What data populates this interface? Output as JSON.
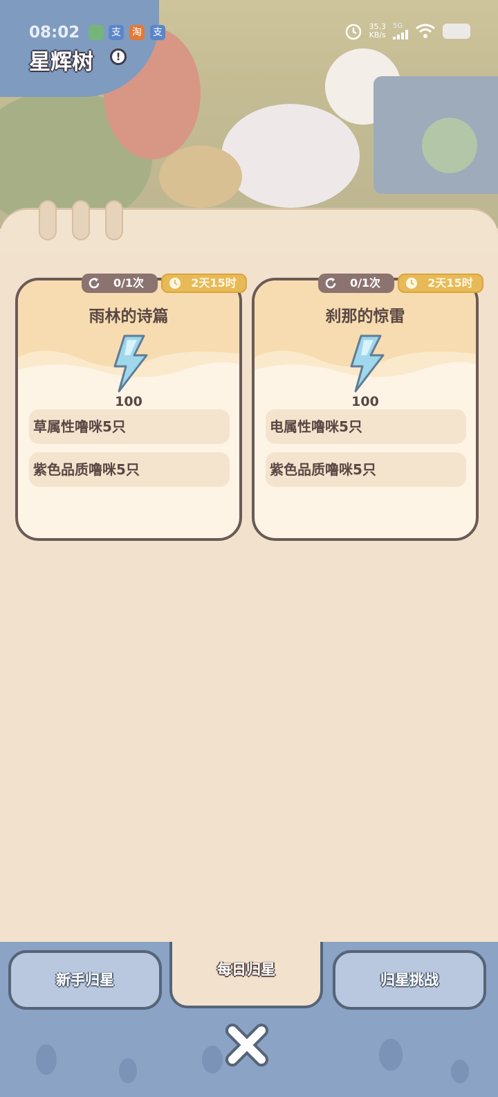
{
  "status_bar": {
    "time": "08:02",
    "apps": [
      "app-icon",
      "alipay-icon",
      "taobao-icon",
      "alipay-icon"
    ],
    "app_glyphs": [
      "",
      "支",
      "淘",
      "支"
    ],
    "speed_value": "35.3",
    "speed_unit": "KB/s",
    "network": "5G"
  },
  "header": {
    "title": "星辉树",
    "info_icon": "exclamation-icon"
  },
  "cards": [
    {
      "title": "雨林的诗篇",
      "attempts": "0/1次",
      "time_left": "2天15时",
      "reward_icon": "lightning-crystal-icon",
      "reward_amount": "100",
      "requirements": [
        "草属性噜咪5只",
        "紫色品质噜咪5只"
      ]
    },
    {
      "title": "刹那的惊雷",
      "attempts": "0/1次",
      "time_left": "2天15时",
      "reward_icon": "lightning-crystal-icon",
      "reward_amount": "100",
      "requirements": [
        "电属性噜咪5只",
        "紫色品质噜咪5只"
      ]
    }
  ],
  "tabs": [
    {
      "label": "新手归星",
      "active": false
    },
    {
      "label": "每日归星",
      "active": true
    },
    {
      "label": "归星挑战",
      "active": false
    }
  ],
  "close_icon": "close-x-icon",
  "colors": {
    "panel_bg": "#f2e1cc",
    "card_border": "#6b5a55",
    "tab_blue": "#b9c8df",
    "bottom_bg": "#8ba3c4",
    "time_pill": "#e7ba57"
  }
}
